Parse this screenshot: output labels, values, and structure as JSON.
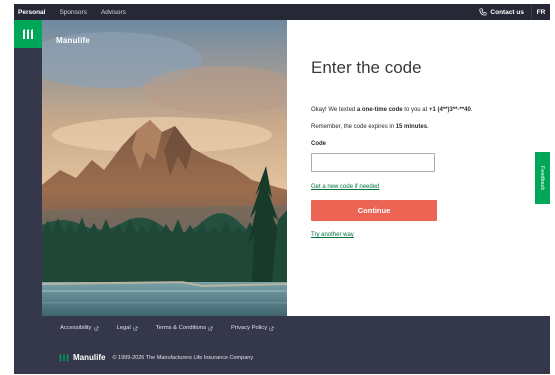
{
  "topbar": {
    "nav": [
      "Personal",
      "Sponsors",
      "Advisors"
    ],
    "contact": "Contact us",
    "lang": "FR"
  },
  "brand": {
    "name": "Manulife"
  },
  "form": {
    "title": "Enter the code",
    "msg_prefix": "Okay! We texted ",
    "msg_bold": "a one-time code",
    "msg_middle": " to you at ",
    "phone": "+1 (4**)3**-**40",
    "msg_end": ".",
    "remember_prefix": "Remember, the code expires in ",
    "remember_bold": "15 minutes",
    "remember_end": ".",
    "code_label": "Code",
    "code_value": "",
    "new_code_link": "Get a new code if needed",
    "continue_label": "Continue",
    "try_another_link": "Try another way"
  },
  "feedback": "Feedback",
  "footer": {
    "links": [
      "Accessibility",
      "Legal",
      "Terms & Conditions",
      "Privacy Policy"
    ],
    "brand": "Manulife",
    "copyright": "© 1999-2026 The Manufacturers Life Insurance Company"
  },
  "colors": {
    "accent_green": "#00a758",
    "button": "#ec6453",
    "dark": "#262935",
    "footer": "#34384a",
    "link": "#00723f"
  }
}
